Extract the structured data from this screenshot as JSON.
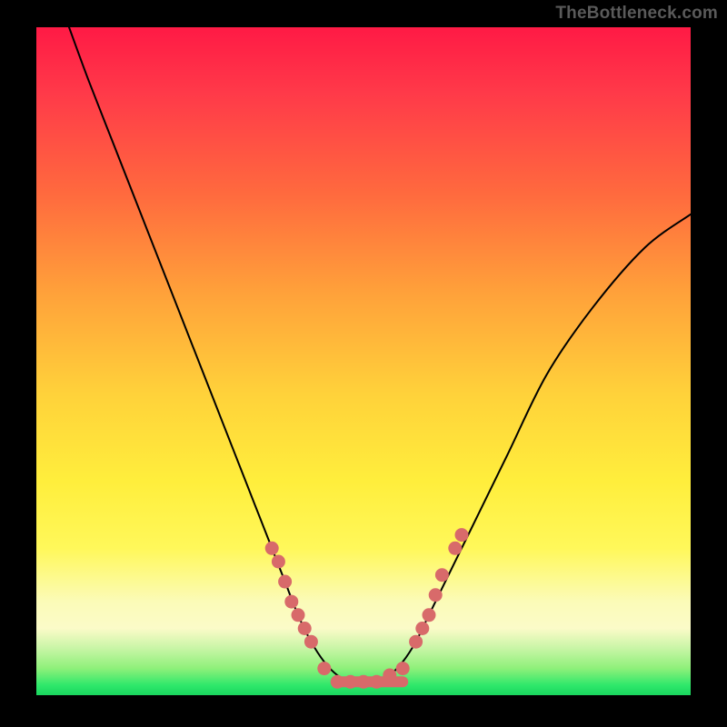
{
  "watermark": "TheBottleneck.com",
  "colors": {
    "dot": "#d86a6a",
    "curve": "#000000",
    "gradient_top": "#ff1a45",
    "gradient_bottom": "#19d65e"
  },
  "chart_data": {
    "type": "line",
    "title": "",
    "xlabel": "",
    "ylabel": "",
    "xlim": [
      0,
      100
    ],
    "ylim": [
      0,
      100
    ],
    "grid": false,
    "legend": false,
    "series": [
      {
        "name": "curve",
        "x": [
          5,
          8,
          12,
          16,
          20,
          24,
          28,
          32,
          34,
          36,
          38,
          40,
          42,
          44,
          46,
          48,
          50,
          52,
          54,
          56,
          58,
          60,
          63,
          67,
          72,
          78,
          85,
          93,
          100
        ],
        "y": [
          100,
          92,
          82,
          72,
          62,
          52,
          42,
          32,
          27,
          22,
          17,
          12,
          8,
          5,
          3,
          2,
          2,
          2,
          3,
          5,
          8,
          12,
          18,
          26,
          36,
          48,
          58,
          67,
          72
        ]
      }
    ],
    "points": [
      {
        "name": "left-cluster-1",
        "x": 36,
        "y": 22
      },
      {
        "name": "left-cluster-2",
        "x": 37,
        "y": 20
      },
      {
        "name": "left-cluster-3",
        "x": 38,
        "y": 17
      },
      {
        "name": "left-cluster-4",
        "x": 39,
        "y": 14
      },
      {
        "name": "left-cluster-5",
        "x": 40,
        "y": 12
      },
      {
        "name": "left-cluster-6",
        "x": 41,
        "y": 10
      },
      {
        "name": "left-cluster-7",
        "x": 42,
        "y": 8
      },
      {
        "name": "trough-1",
        "x": 44,
        "y": 4
      },
      {
        "name": "trough-2",
        "x": 46,
        "y": 2
      },
      {
        "name": "trough-3",
        "x": 48,
        "y": 2
      },
      {
        "name": "trough-4",
        "x": 50,
        "y": 2
      },
      {
        "name": "trough-5",
        "x": 52,
        "y": 2
      },
      {
        "name": "trough-6",
        "x": 54,
        "y": 3
      },
      {
        "name": "trough-7",
        "x": 56,
        "y": 4
      },
      {
        "name": "right-cluster-1",
        "x": 58,
        "y": 8
      },
      {
        "name": "right-cluster-2",
        "x": 59,
        "y": 10
      },
      {
        "name": "right-cluster-3",
        "x": 60,
        "y": 12
      },
      {
        "name": "right-cluster-4",
        "x": 61,
        "y": 15
      },
      {
        "name": "right-cluster-5",
        "x": 62,
        "y": 18
      },
      {
        "name": "right-cluster-6",
        "x": 64,
        "y": 22
      },
      {
        "name": "right-cluster-7",
        "x": 65,
        "y": 24
      }
    ],
    "trough_band": {
      "x_start": 46,
      "x_end": 56,
      "y": 2
    }
  }
}
